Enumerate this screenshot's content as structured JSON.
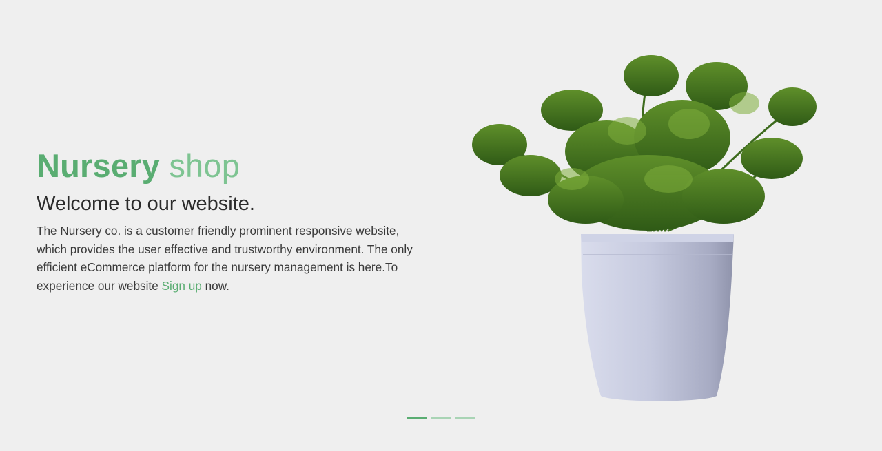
{
  "hero": {
    "title_bold": "Nursery",
    "title_light": "shop",
    "subtitle": "Welcome to our website.",
    "description_before_link": "The Nursery co. is a customer friendly prominent responsive website, which provides the user effective and trustworthy environment. The only efficient eCommerce platform for the nursery management is here.To experience our website ",
    "signup_link": "Sign up",
    "description_after_link": " now."
  },
  "carousel": {
    "slides": [
      {
        "active": true
      },
      {
        "active": false
      },
      {
        "active": false
      }
    ]
  },
  "colors": {
    "accent": "#5aad72",
    "accent_light": "#a9d4b5",
    "background": "#efefef",
    "pot": "#c9cde3"
  },
  "image": {
    "icon": "potted-plant-image"
  }
}
